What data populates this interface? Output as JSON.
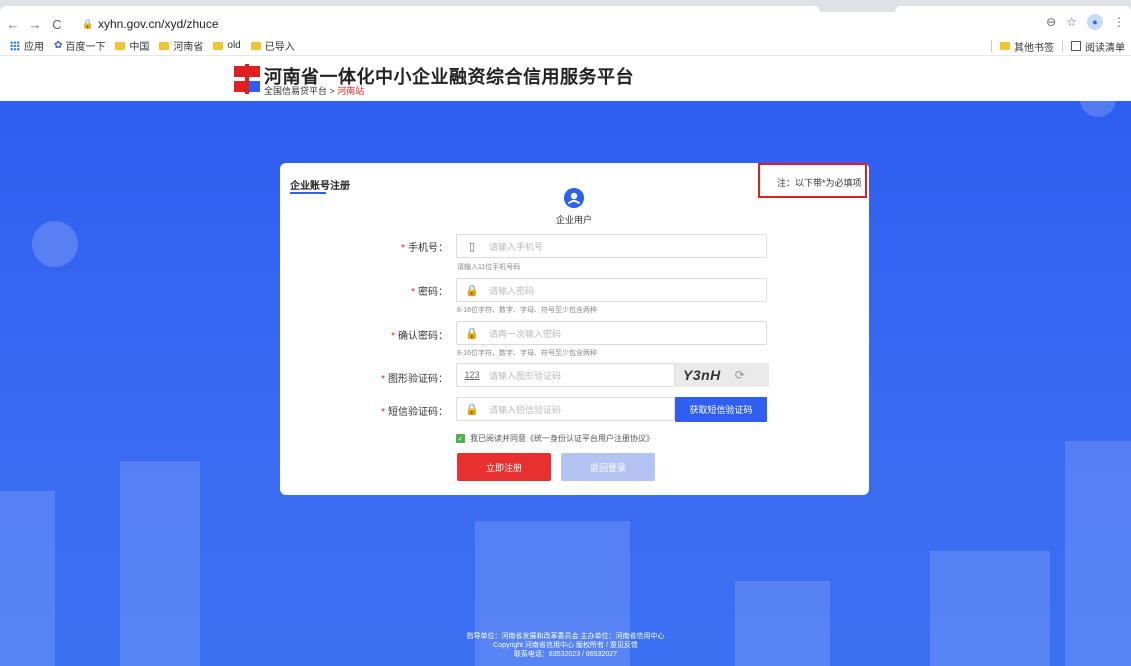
{
  "browser": {
    "url": "xyhn.gov.cn/xyd/zhuce",
    "bookmarks": [
      "应用",
      "百度一下",
      "中国",
      "河南省",
      "old",
      "已导入"
    ],
    "other_bookmarks": "其他书签",
    "reading_list": "阅读清单"
  },
  "site": {
    "title": "河南省一体化中小企业融资综合信用服务平台",
    "sub_prefix": "全国信易贷平台 > ",
    "sub_highlight": "河南站"
  },
  "card": {
    "title": "企业账号注册",
    "note": "注：以下带*为必填项",
    "user_type": "企业用户"
  },
  "form": {
    "phone": {
      "label": "手机号：",
      "placeholder": "请输入手机号",
      "hint": "请输入11位手机号码"
    },
    "password": {
      "label": "密码：",
      "placeholder": "请输入密码",
      "hint": "8-16位字符、数字、字母、符号至少包含两种"
    },
    "confirm": {
      "label": "确认密码：",
      "placeholder": "请再一次输入密码",
      "hint": "8-16位字符、数字、字母、符号至少包含两种"
    },
    "captcha": {
      "label": "图形验证码：",
      "placeholder": "请输入图形验证码",
      "code": "Y3nH"
    },
    "sms": {
      "label": "短信验证码：",
      "placeholder": "请输入短信验证码",
      "button": "获取短信验证码"
    },
    "agree": "我已阅读并同意《统一身份认证平台用户注册协议》",
    "register_button": "立即注册",
    "back_button": "返回登录"
  },
  "footer": {
    "line1": "指导单位：河南省发展和改革委员会    主办单位：河南省信用中心",
    "line2": "Copyright 河南省信用中心 版权所有 / 意见反馈",
    "line3": "联系电话：83532023 / 86532027"
  }
}
